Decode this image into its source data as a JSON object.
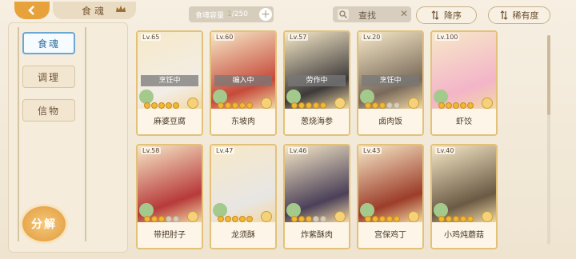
{
  "header": {
    "page_title": "食魂",
    "capacity_label": "食魂容量",
    "capacity_used": "1",
    "capacity_total": "250",
    "capacity_add": "+",
    "search_label": "查找",
    "search_clear": "✕",
    "sort_desc_label": "降序",
    "sort_rarity_label": "稀有度"
  },
  "sidebar": {
    "tabs": [
      {
        "label": "食魂",
        "active": true
      },
      {
        "label": "调理",
        "active": false
      },
      {
        "label": "信物",
        "active": false
      }
    ],
    "decompose_label": "分解"
  },
  "cards": [
    {
      "level": "Lv.65",
      "name": "麻婆豆腐",
      "status": "烹饪中",
      "stars": 5,
      "color": "#f2ede6"
    },
    {
      "level": "Lv.60",
      "name": "东坡肉",
      "status": "编入中",
      "stars": 5,
      "color": "#c64a3a"
    },
    {
      "level": "Lv.57",
      "name": "葱烧海参",
      "status": "劳作中",
      "stars": 5,
      "color": "#3d3a3a"
    },
    {
      "level": "Lv.20",
      "name": "卤肉饭",
      "status": "烹饪中",
      "stars": 3,
      "color": "#7a6a5a"
    },
    {
      "level": "Lv.100",
      "name": "虾饺",
      "status": "",
      "stars": 5,
      "color": "#f3b4c8"
    },
    {
      "level": "Lv.58",
      "name": "带把肘子",
      "status": "",
      "stars": 3,
      "color": "#b73a3a"
    },
    {
      "level": "Lv.47",
      "name": "龙须酥",
      "status": "",
      "stars": 5,
      "color": "#e8e6e4"
    },
    {
      "level": "Lv.46",
      "name": "炸紫酥肉",
      "status": "",
      "stars": 3,
      "color": "#4b4058"
    },
    {
      "level": "Lv.43",
      "name": "宫保鸡丁",
      "status": "",
      "stars": 5,
      "color": "#9c3d2a"
    },
    {
      "level": "Lv.40",
      "name": "小鸡炖蘑菇",
      "status": "",
      "stars": 5,
      "color": "#6b5a44"
    }
  ],
  "colors": {
    "accent": "#e7a23c",
    "active_tab": "#6aa7d3",
    "card_border": "#e3c179"
  }
}
